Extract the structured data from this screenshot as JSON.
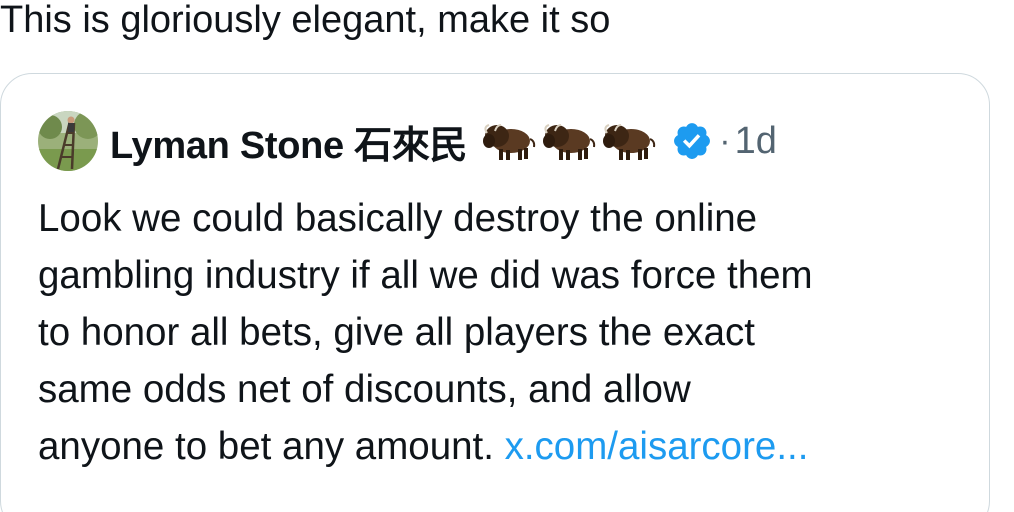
{
  "post": {
    "text": "This is gloriously elegant, make it so"
  },
  "quoted_tweet": {
    "author_name": "Lyman Stone 石來民",
    "emoji_icons": [
      "bison-icon",
      "bison-icon",
      "bison-icon"
    ],
    "verified_icon": "verified-badge-icon",
    "separator": "·",
    "timestamp": "1d",
    "body_lines": [
      "Look we could basically destroy the online",
      "gambling industry if all we did was force them",
      "to honor all bets, give all players the exact",
      "same odds net of discounts, and allow",
      "anyone to bet any amount. "
    ],
    "link_text": "x.com/aisarcore...",
    "colors": {
      "text": "#0f1419",
      "muted": "#536471",
      "link": "#1d9bf0",
      "verified": "#1d9bf0",
      "border": "#cfd9de"
    }
  }
}
